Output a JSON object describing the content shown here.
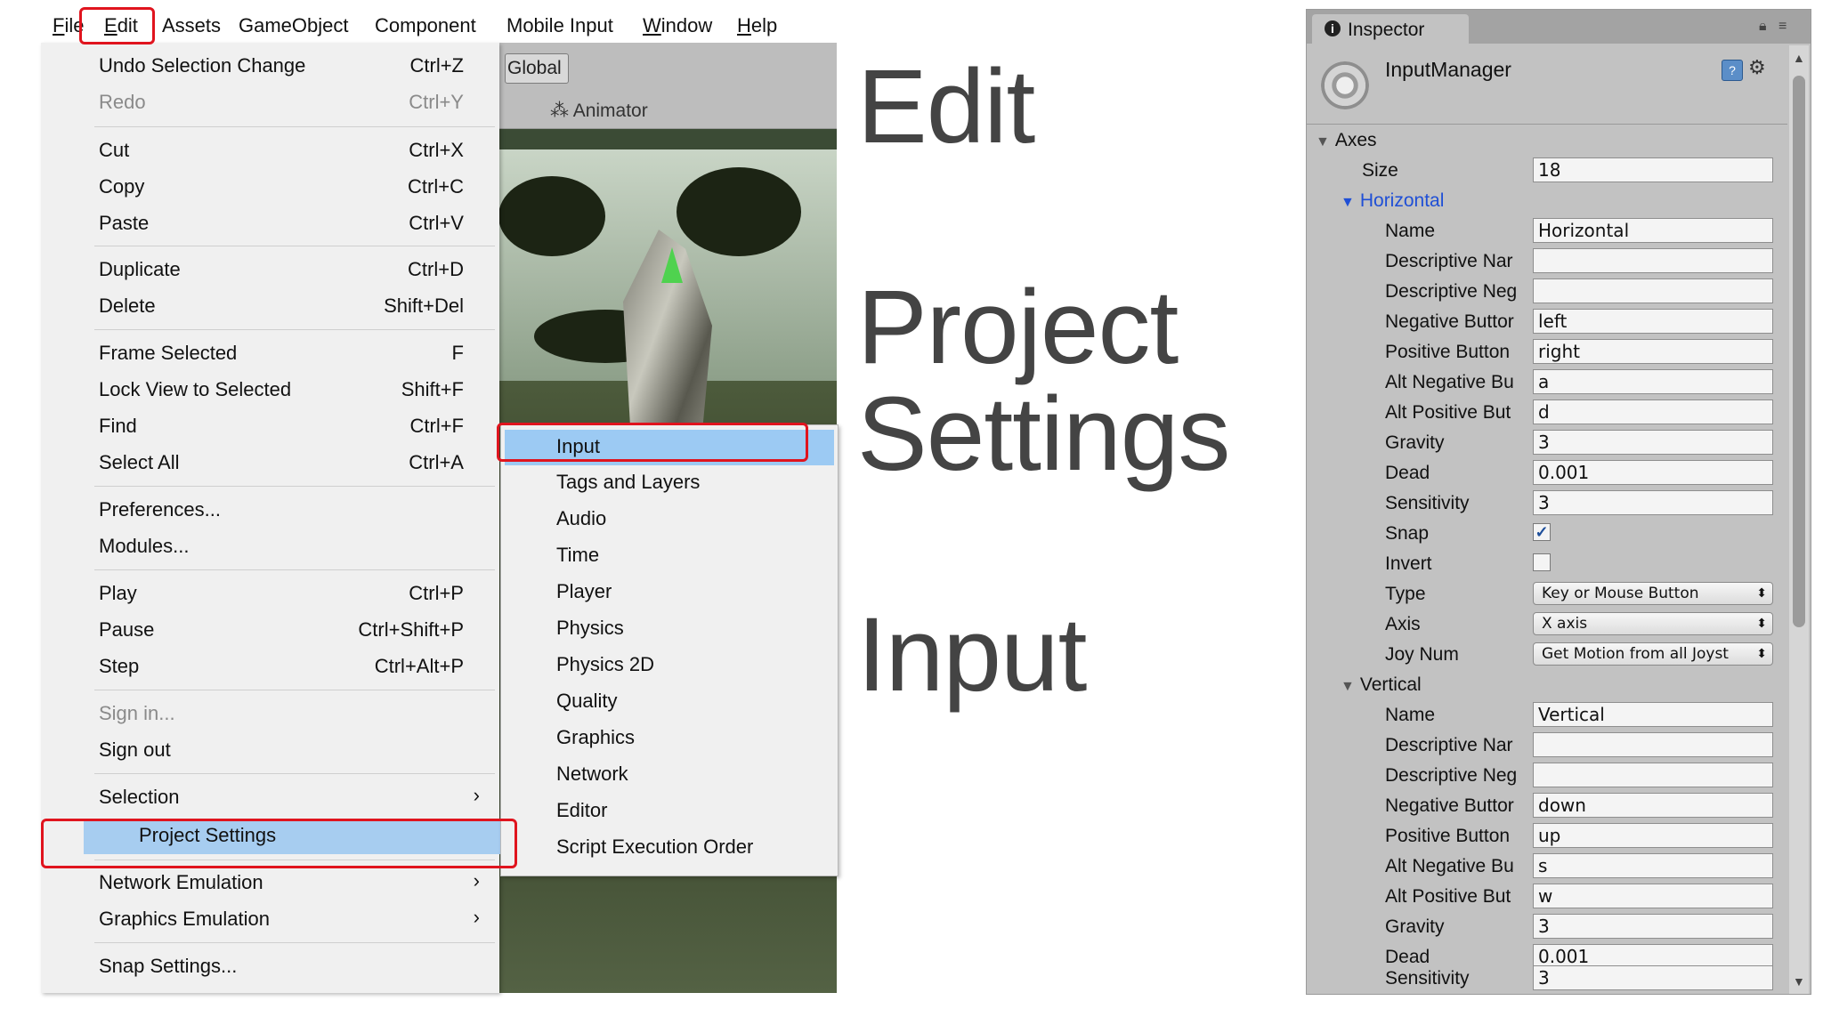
{
  "menubar": {
    "items": [
      "File",
      "Edit",
      "Assets",
      "GameObject",
      "Component",
      "Mobile Input",
      "Window",
      "Help"
    ]
  },
  "scene": {
    "global_label": "Global",
    "animator_label": "Animator"
  },
  "edit_menu": {
    "items": [
      {
        "label": "Undo Selection Change",
        "shortcut": "Ctrl+Z"
      },
      {
        "label": "Redo",
        "shortcut": "Ctrl+Y"
      },
      {
        "label": "Cut",
        "shortcut": "Ctrl+X"
      },
      {
        "label": "Copy",
        "shortcut": "Ctrl+C"
      },
      {
        "label": "Paste",
        "shortcut": "Ctrl+V"
      },
      {
        "label": "Duplicate",
        "shortcut": "Ctrl+D"
      },
      {
        "label": "Delete",
        "shortcut": "Shift+Del"
      },
      {
        "label": "Frame Selected",
        "shortcut": "F"
      },
      {
        "label": "Lock View to Selected",
        "shortcut": "Shift+F"
      },
      {
        "label": "Find",
        "shortcut": "Ctrl+F"
      },
      {
        "label": "Select All",
        "shortcut": "Ctrl+A"
      },
      {
        "label": "Preferences..."
      },
      {
        "label": "Modules..."
      },
      {
        "label": "Play",
        "shortcut": "Ctrl+P"
      },
      {
        "label": "Pause",
        "shortcut": "Ctrl+Shift+P"
      },
      {
        "label": "Step",
        "shortcut": "Ctrl+Alt+P"
      },
      {
        "label": "Sign in..."
      },
      {
        "label": "Sign out"
      },
      {
        "label": "Selection"
      },
      {
        "label": "Project Settings"
      },
      {
        "label": "Network Emulation"
      },
      {
        "label": "Graphics Emulation"
      },
      {
        "label": "Snap Settings..."
      }
    ],
    "submenu_arrow": "›"
  },
  "project_settings_submenu": {
    "items": [
      "Input",
      "Tags and Layers",
      "Audio",
      "Time",
      "Player",
      "Physics",
      "Physics 2D",
      "Quality",
      "Graphics",
      "Network",
      "Editor",
      "Script Execution Order"
    ]
  },
  "captions": {
    "edit": "Edit",
    "project": "Project",
    "settings": "Settings",
    "input": "Input"
  },
  "inspector": {
    "tab_label": "Inspector",
    "title": "InputManager",
    "axes_label": "Axes",
    "size_label": "Size",
    "size_value": "18",
    "horizontal": {
      "header": "Horizontal",
      "fields": [
        {
          "label": "Name",
          "value": "Horizontal"
        },
        {
          "label": "Descriptive Nar",
          "value": ""
        },
        {
          "label": "Descriptive Neg",
          "value": ""
        },
        {
          "label": "Negative Buttor",
          "value": "left"
        },
        {
          "label": "Positive Button",
          "value": "right"
        },
        {
          "label": "Alt Negative Bu",
          "value": "a"
        },
        {
          "label": "Alt Positive But",
          "value": "d"
        },
        {
          "label": "Gravity",
          "value": "3"
        },
        {
          "label": "Dead",
          "value": "0.001"
        },
        {
          "label": "Sensitivity",
          "value": "3"
        }
      ],
      "snap_label": "Snap",
      "invert_label": "Invert",
      "type_label": "Type",
      "type_value": "Key or Mouse Button",
      "axis_label": "Axis",
      "axis_value": "X axis",
      "joy_label": "Joy Num",
      "joy_value": "Get Motion from all Joyst"
    },
    "vertical": {
      "header": "Vertical",
      "fields": [
        {
          "label": "Name",
          "value": "Vertical"
        },
        {
          "label": "Descriptive Nar",
          "value": ""
        },
        {
          "label": "Descriptive Neg",
          "value": ""
        },
        {
          "label": "Negative Buttor",
          "value": "down"
        },
        {
          "label": "Positive Button",
          "value": "up"
        },
        {
          "label": "Alt Negative Bu",
          "value": "s"
        },
        {
          "label": "Alt Positive But",
          "value": "w"
        },
        {
          "label": "Gravity",
          "value": "3"
        },
        {
          "label": "Dead",
          "value": "0.001"
        },
        {
          "label": "Sensitivity",
          "value": "3"
        }
      ]
    },
    "snap_checked": true,
    "invert_checked": false
  },
  "colors": {
    "highlight_red": "#e0141e",
    "menu_selection": "#a7cdf0",
    "foldout_blue": "#1f4fd6"
  }
}
